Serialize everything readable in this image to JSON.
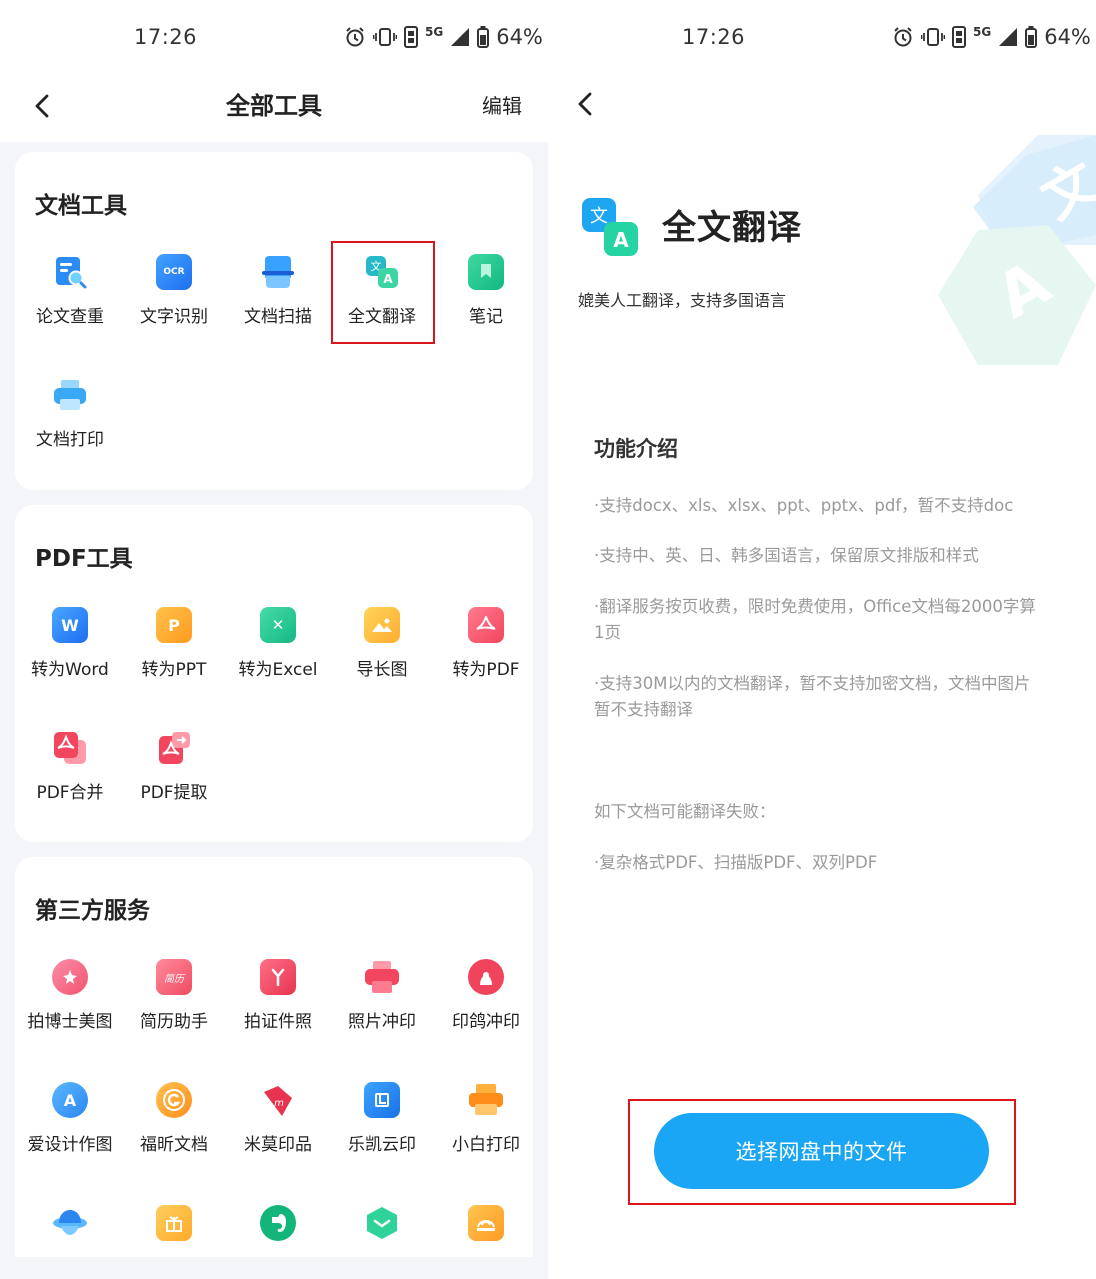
{
  "status_bar": {
    "time": "17:26",
    "signal": "5G",
    "battery": "64%"
  },
  "left": {
    "header": {
      "title": "全部工具",
      "edit": "编辑"
    },
    "doc_tools": {
      "title": "文档工具",
      "items": [
        {
          "label": "论文查重",
          "icon": "paper-check-icon"
        },
        {
          "label": "文字识别",
          "icon": "ocr-icon",
          "icon_text": "OCR"
        },
        {
          "label": "文档扫描",
          "icon": "doc-scan-icon"
        },
        {
          "label": "全文翻译",
          "icon": "translate-icon"
        },
        {
          "label": "笔记",
          "icon": "note-icon"
        },
        {
          "label": "文档打印",
          "icon": "printer-icon"
        }
      ]
    },
    "pdf_tools": {
      "title": "PDF工具",
      "items": [
        {
          "label": "转为Word",
          "icon": "word-icon",
          "icon_text": "W"
        },
        {
          "label": "转为PPT",
          "icon": "ppt-icon",
          "icon_text": "P"
        },
        {
          "label": "转为Excel",
          "icon": "excel-icon",
          "icon_text": "✕"
        },
        {
          "label": "导长图",
          "icon": "long-image-icon"
        },
        {
          "label": "转为PDF",
          "icon": "pdf-icon"
        },
        {
          "label": "PDF合并",
          "icon": "pdf-merge-icon"
        },
        {
          "label": "PDF提取",
          "icon": "pdf-extract-icon"
        }
      ]
    },
    "third_party": {
      "title": "第三方服务",
      "items": [
        {
          "label": "拍博士美图",
          "icon": "photo-beauty-icon"
        },
        {
          "label": "简历助手",
          "icon": "resume-icon",
          "icon_text": "简历"
        },
        {
          "label": "拍证件照",
          "icon": "id-photo-icon"
        },
        {
          "label": "照片冲印",
          "icon": "photo-print-icon"
        },
        {
          "label": "印鸽冲印",
          "icon": "yinge-icon"
        },
        {
          "label": "爱设计作图",
          "icon": "design-icon"
        },
        {
          "label": "福昕文档",
          "icon": "foxit-icon"
        },
        {
          "label": "米莫印品",
          "icon": "mimo-icon"
        },
        {
          "label": "乐凯云印",
          "icon": "lekai-icon"
        },
        {
          "label": "小白打印",
          "icon": "xiaobai-print-icon"
        },
        {
          "label": "",
          "icon": "cloud-hat-icon"
        },
        {
          "label": "",
          "icon": "gift-icon"
        },
        {
          "label": "",
          "icon": "evernote-icon"
        },
        {
          "label": "",
          "icon": "green-box-icon"
        },
        {
          "label": "",
          "icon": "orange-print-icon"
        }
      ]
    }
  },
  "right": {
    "title": "全文翻译",
    "subtitle": "媲美人工翻译，支持多国语言",
    "section_title": "功能介绍",
    "features": [
      "·支持docx、xls、xlsx、ppt、pptx、pdf，暂不支持doc",
      "·支持中、英、日、韩多国语言，保留原文排版和样式",
      "·翻译服务按页收费，限时免费使用，Office文档每2000字算1页",
      "·支持30M以内的文档翻译，暂不支持加密文档，文档中图片暂不支持翻译"
    ],
    "fail_title": "如下文档可能翻译失败：",
    "fail_item": "·复杂格式PDF、扫描版PDF、双列PDF",
    "cta": "选择网盘中的文件"
  },
  "colors": {
    "accent": "#1aa6f5",
    "highlight": "#d9161c"
  }
}
